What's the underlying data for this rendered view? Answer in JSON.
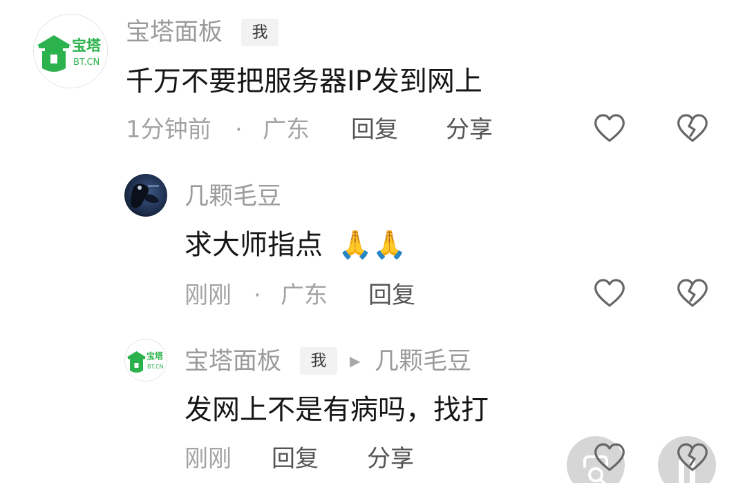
{
  "comments": [
    {
      "author": "宝塔面板",
      "badge": "我",
      "avatar_text_cn": "宝塔",
      "avatar_text_en": "BT.CN",
      "text": "千万不要把服务器IP发到网上",
      "time": "1分钟前",
      "separator": "·",
      "location": "广东",
      "reply_label": "回复",
      "share_label": "分享"
    },
    {
      "author": "几颗毛豆",
      "text": "求大师指点",
      "emoji": "🙏🙏",
      "time": "刚刚",
      "separator": "·",
      "location": "广东",
      "reply_label": "回复"
    },
    {
      "author": "宝塔面板",
      "badge": "我",
      "avatar_text_cn": "宝塔",
      "avatar_text_en": "BT.CN",
      "reply_arrow": "▶",
      "reply_to": "几颗毛豆",
      "text": "发网上不是有病吗，找打",
      "time": "刚刚",
      "reply_label": "回复",
      "share_label": "分享"
    }
  ],
  "icons": {
    "like": "heart-outline-icon",
    "dislike": "broken-heart-icon",
    "float_left": "scan-search-icon",
    "float_right": "pause-icon"
  },
  "colors": {
    "brand_green": "#2bb24c",
    "name_gray": "#9b9b9b",
    "meta_gray": "#a3a3a3",
    "text_dark": "#161616",
    "icon_gray": "#666666"
  }
}
